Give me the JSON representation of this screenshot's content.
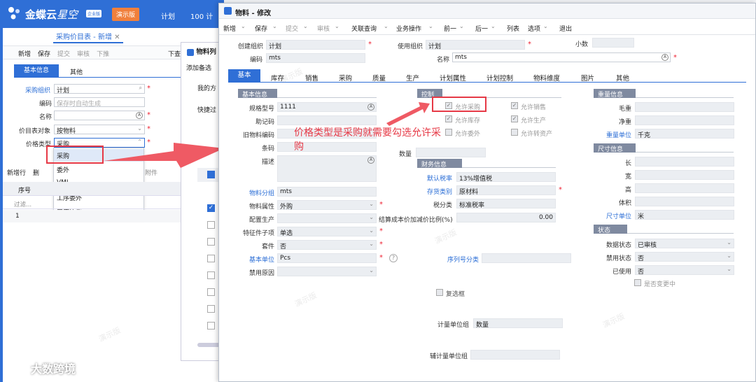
{
  "app": {
    "brand": "金蝶云",
    "brand2": "星空",
    "edition": "企业版",
    "demo": "演示版",
    "top_item1": "计划",
    "top_item2": "100 计"
  },
  "back": {
    "tab_label": "采购价目表 - 新增",
    "toolbar": [
      "新增",
      "保存",
      "提交",
      "审核",
      "下推"
    ],
    "toolbar_extra": "下查",
    "inner_tabs": [
      "基本信息",
      "其他"
    ],
    "fields": {
      "org": {
        "label": "采购组织",
        "value": "计划"
      },
      "code": {
        "label": "编码",
        "placeholder": "保存时自动生成"
      },
      "name": {
        "label": "名称",
        "value": ""
      },
      "object": {
        "label": "价目表对象",
        "value": "按物料"
      },
      "price_type": {
        "label": "价格类型",
        "value": "采购"
      }
    },
    "dropdown_options": [
      "采购",
      "委外",
      "VMI",
      "工序委外",
      "工序协作"
    ],
    "grid_toolbar": [
      "新增行",
      "删",
      "附件"
    ],
    "grid_headers": [
      "序号"
    ],
    "grid_filter": "过滤...",
    "grid_row": "1"
  },
  "mid": {
    "title": "物料列",
    "add_label": "添加备选",
    "row1": "我的方",
    "row2": "快捷过"
  },
  "main": {
    "title": "物料 - 修改",
    "toolbar": [
      "新增",
      "保存",
      "提交",
      "审核",
      "关联查询",
      "业务操作",
      "前一",
      "后一",
      "列表",
      "选项",
      "退出"
    ],
    "header": {
      "create_org_label": "创建组织",
      "create_org": "计划",
      "use_org_label": "使用组织",
      "use_org": "计划",
      "decimal_label": "小数",
      "code_label": "编码",
      "code": "mts",
      "name_label": "名称",
      "name": "mts"
    },
    "tabs": [
      "基本",
      "库存",
      "销售",
      "采购",
      "质量",
      "生产",
      "计划属性",
      "计划控制",
      "物料维度",
      "图片",
      "其他"
    ],
    "basic_section": "基本信息",
    "basic": {
      "spec_label": "规格型号",
      "spec": "1111",
      "mnemonic_label": "助记码",
      "oldcode_label": "旧物料编码",
      "barcode_label": "条码",
      "desc_label": "描述",
      "group_label": "物料分组",
      "group": "mts",
      "prop_label": "物料属性",
      "prop": "外购",
      "config_label": "配置生产",
      "feature_label": "特征件子项",
      "feature": "单选",
      "kit_label": "套件",
      "kit": "否",
      "unit_label": "基本单位",
      "unit": "Pcs",
      "forbid_label": "禁用原因"
    },
    "control_section": "控制",
    "controls": [
      "允许采购",
      "允许销售",
      "允许库存",
      "允许生产",
      "允许委外",
      "允许转资产"
    ],
    "qty_label": "数量",
    "finance_section": "财务信息",
    "finance": {
      "tax_label": "默认税率",
      "tax": "13%增值税",
      "cat_label": "存货类别",
      "cat": "原材料",
      "taxcat_label": "税分类",
      "taxcat": "标准税率",
      "ratio_label": "结算成本价加减价比例(%)",
      "ratio": "0.00",
      "serial_label": "序列号分类"
    },
    "checkbox_label": "复选框",
    "unitgroup_label": "计量单位组",
    "unitgroup": "数量",
    "aux_label": "辅计量单位组",
    "weight_section": "重量信息",
    "weight": {
      "gross": "毛重",
      "net": "净重",
      "unit_label": "重量单位",
      "unit": "千克"
    },
    "size_section": "尺寸信息",
    "size": {
      "l": "长",
      "w": "宽",
      "h": "高",
      "v": "体积",
      "unit_label": "尺寸单位",
      "unit": "米"
    },
    "status_section": "状态",
    "status": {
      "data_label": "数据状态",
      "data": "已审核",
      "forbid_label": "禁用状态",
      "forbid": "否",
      "used_label": "已使用",
      "used": "否",
      "changing": "是否变更中"
    }
  },
  "annotation": "价格类型是采购就需要勾选允许采购",
  "watermark": "演示版",
  "footer_logo": "大数跨境",
  "colors": {
    "accent": "#2b6ed6",
    "annotation": "#e63946",
    "section": "#7f8aa0"
  }
}
